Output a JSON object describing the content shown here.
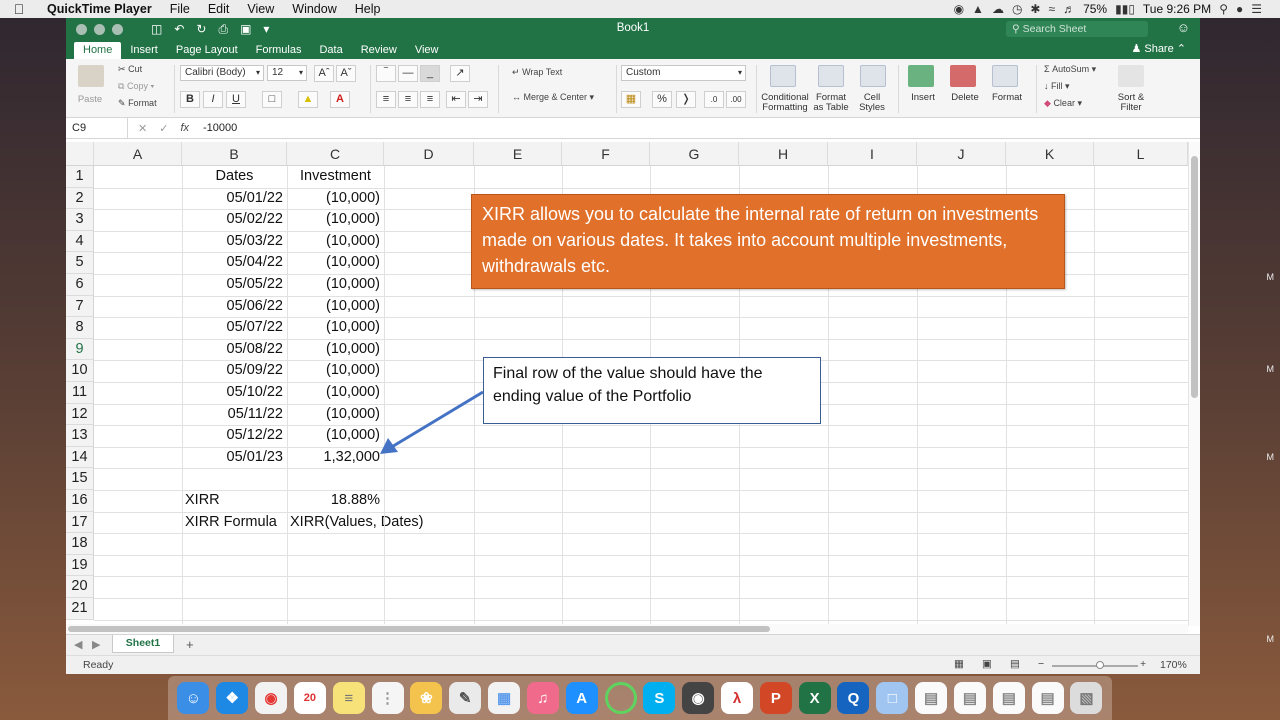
{
  "menubar": {
    "apple": "",
    "app_name": "QuickTime Player",
    "items": [
      "File",
      "Edit",
      "View",
      "Window",
      "Help"
    ],
    "battery": "75%",
    "clock": "Tue 9:26 PM"
  },
  "window": {
    "title": "Book1",
    "search_placeholder": "Search Sheet",
    "share_label": "Share",
    "tabs": [
      "Home",
      "Insert",
      "Page Layout",
      "Formulas",
      "Data",
      "Review",
      "View"
    ],
    "active_tab": "Home"
  },
  "ribbon": {
    "paste": "Paste",
    "cut": "Cut",
    "copy": "Copy",
    "format": "Format",
    "font_name": "Calibri (Body)",
    "font_size": "12",
    "wrap_text": "Wrap Text",
    "merge_center": "Merge & Center",
    "number_format": "Custom",
    "conditional_formatting": "Conditional Formatting",
    "format_as_table": "Format as Table",
    "cell_styles": "Cell Styles",
    "insert": "Insert",
    "delete": "Delete",
    "format_cells": "Format",
    "autosum": "AutoSum",
    "fill": "Fill",
    "clear": "Clear",
    "sort_filter": "Sort & Filter"
  },
  "formula_bar": {
    "name_box": "C9",
    "fx": "fx",
    "value": "-10000"
  },
  "columns": [
    "A",
    "B",
    "C",
    "D",
    "E",
    "F",
    "G",
    "H",
    "I",
    "J",
    "K",
    "L"
  ],
  "rows": [
    "1",
    "2",
    "3",
    "4",
    "5",
    "6",
    "7",
    "8",
    "9",
    "10",
    "11",
    "12",
    "13",
    "14",
    "15",
    "16",
    "17",
    "18",
    "19",
    "20",
    "21"
  ],
  "cells": {
    "B1": "Dates",
    "C1": "Investment",
    "B2": "05/01/22",
    "C2": "(10,000)",
    "B3": "05/02/22",
    "C3": "(10,000)",
    "B4": "05/03/22",
    "C4": "(10,000)",
    "B5": "05/04/22",
    "C5": "(10,000)",
    "B6": "05/05/22",
    "C6": "(10,000)",
    "B7": "05/06/22",
    "C7": "(10,000)",
    "B8": "05/07/22",
    "C8": "(10,000)",
    "B9": "05/08/22",
    "C9": "(10,000)",
    "B10": "05/09/22",
    "C10": "(10,000)",
    "B11": "05/10/22",
    "C11": "(10,000)",
    "B12": "05/11/22",
    "C12": "(10,000)",
    "B13": "05/12/22",
    "C13": "(10,000)",
    "B14": "05/01/23",
    "C14": "1,32,000",
    "B16": "XIRR",
    "C16": "18.88%",
    "B17": "XIRR Formula",
    "C17": "XIRR(Values, Dates)"
  },
  "shapes": {
    "orange_note": "XIRR allows you to calculate the internal rate of return on investments made on various dates. It takes into account multiple investments, withdrawals etc.",
    "callout_note": "Final row of the value should have the ending value of the Portfolio",
    "orange_color": "#e0702a",
    "arrow_color": "#4472c4"
  },
  "sheet_tab": "Sheet1",
  "add_sheet": "+",
  "status": {
    "ready": "Ready",
    "zoom": "170%"
  },
  "colors": {
    "excel_green": "#217346"
  }
}
